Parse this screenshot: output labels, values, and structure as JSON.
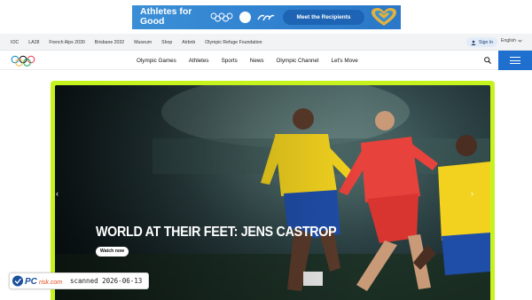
{
  "ad": {
    "headline": "Athletes for Good",
    "cta_label": "Meet the Recipients",
    "bg_color": "#3b8fd6",
    "heart_color": "#e2b23a"
  },
  "utility_nav": {
    "links": [
      "IOC",
      "LA28",
      "French Alps 2030",
      "Brisbane 2032",
      "Museum",
      "Shop",
      "Airbnb",
      "Olympic Refuge Foundation"
    ],
    "sign_in_label": "Sign In",
    "language": "English"
  },
  "main_nav": {
    "items": [
      "Olympic Games",
      "Athletes",
      "Sports",
      "News",
      "Olympic Channel",
      "Let's Move"
    ],
    "accent_color": "#1f6fcf"
  },
  "hero": {
    "title": "WORLD AT THEIR FEET: JENS CASTROP",
    "watch_label": "Watch now",
    "frame_color": "#c6f21e"
  },
  "watermark": {
    "brand": "PCrisk.com",
    "scan_text": "scanned 2026-06-13"
  }
}
